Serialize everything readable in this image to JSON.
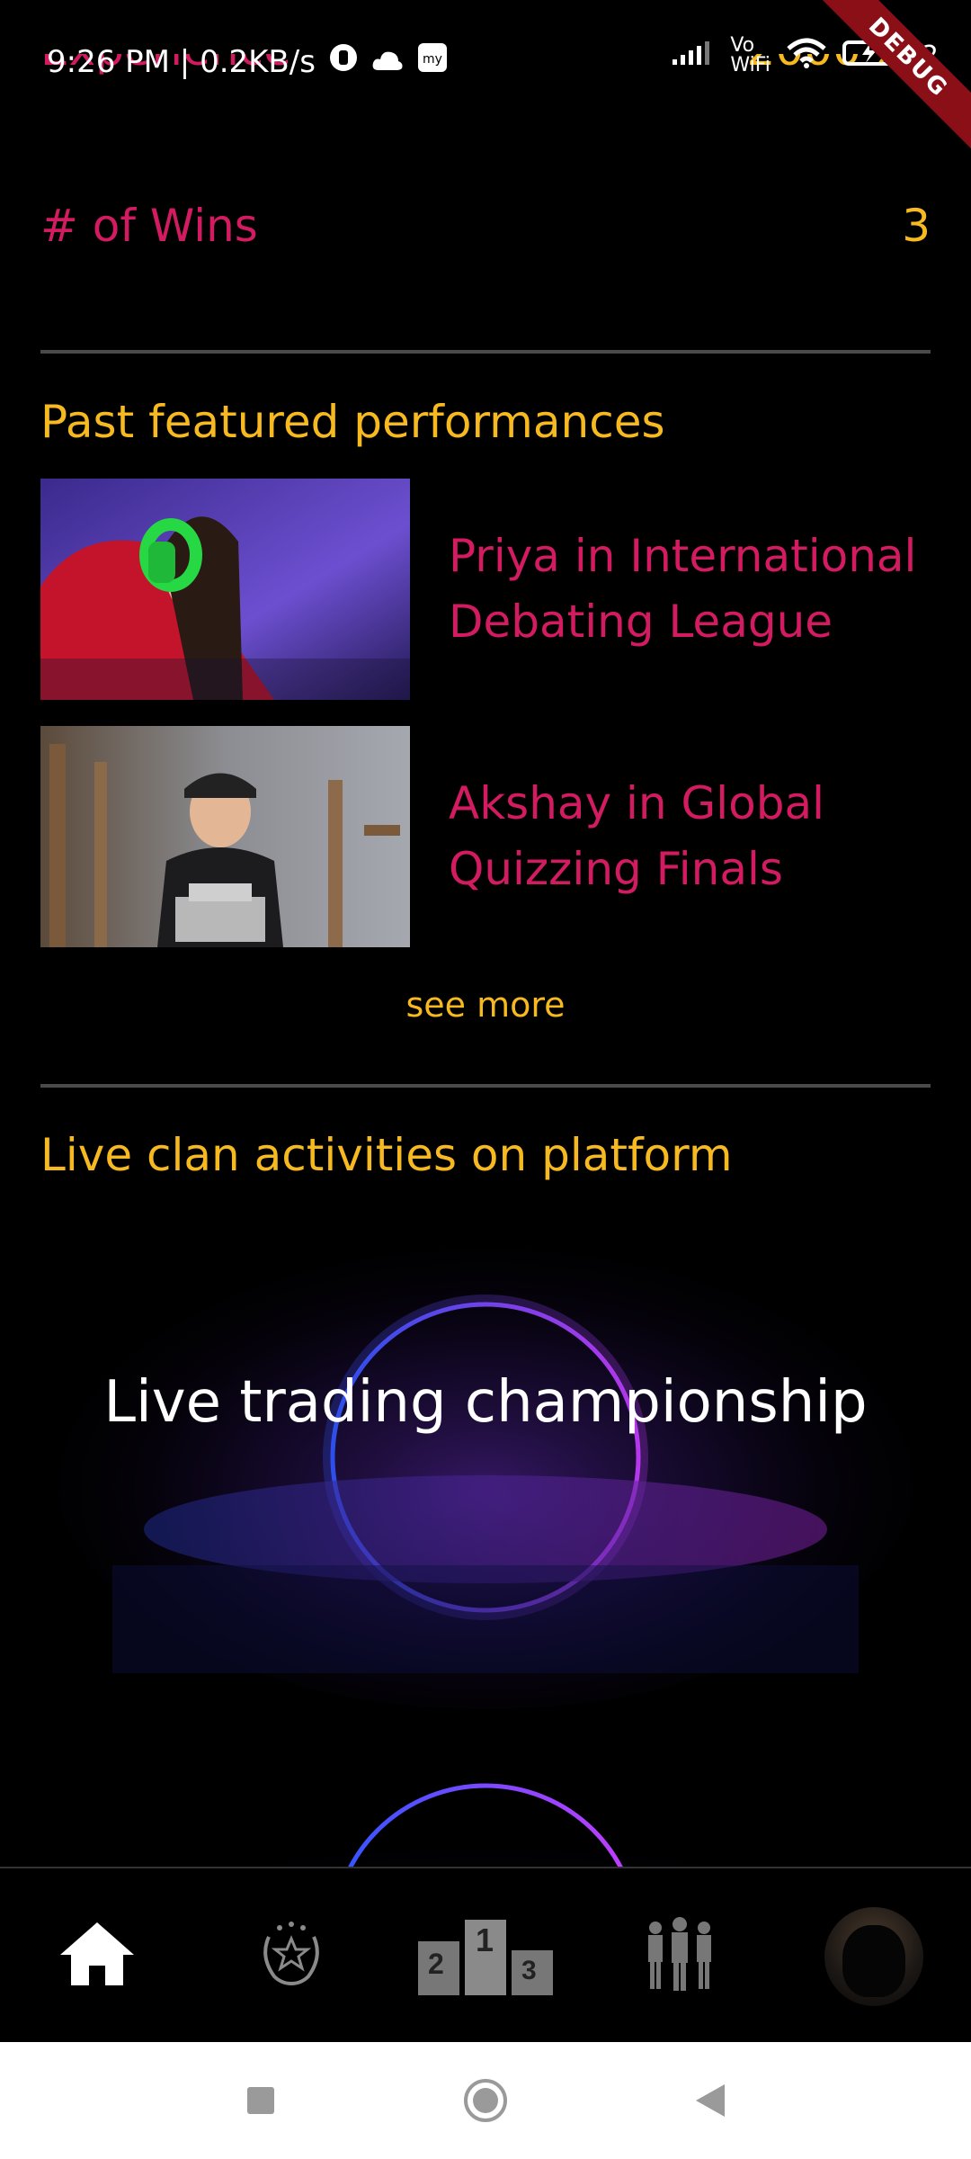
{
  "status_bar": {
    "time_speed": "9:26 PM | 0.2KB/s",
    "network_label_top": "Vo",
    "network_label_bottom": "WiFi",
    "battery_partial": "2",
    "debug_label": "DEBUG"
  },
  "stats": {
    "experience_label": "Experience",
    "experience_value": "2000 xp",
    "wins_label": "# of Wins",
    "wins_value": "3"
  },
  "past_performances": {
    "title": "Past featured performances",
    "items": [
      {
        "title": "Priya in International Debating League"
      },
      {
        "title": "Akshay in Global Quizzing Finals"
      }
    ],
    "see_more": "see more"
  },
  "live_activities": {
    "title": "Live clan activities on platform",
    "cards": [
      {
        "title": "Live trading championship"
      }
    ]
  },
  "bottom_nav": {
    "items": [
      {
        "icon": "home-icon",
        "active": true
      },
      {
        "icon": "laurel-star-icon",
        "active": false
      },
      {
        "icon": "podium-icon",
        "active": false
      },
      {
        "icon": "team-icon",
        "active": false
      },
      {
        "icon": "profile-avatar",
        "active": false
      }
    ],
    "podium_numbers": [
      "2",
      "1",
      "3"
    ]
  },
  "colors": {
    "accent_pink": "#d21b60",
    "accent_yellow": "#f6b91f",
    "background": "#000000"
  }
}
